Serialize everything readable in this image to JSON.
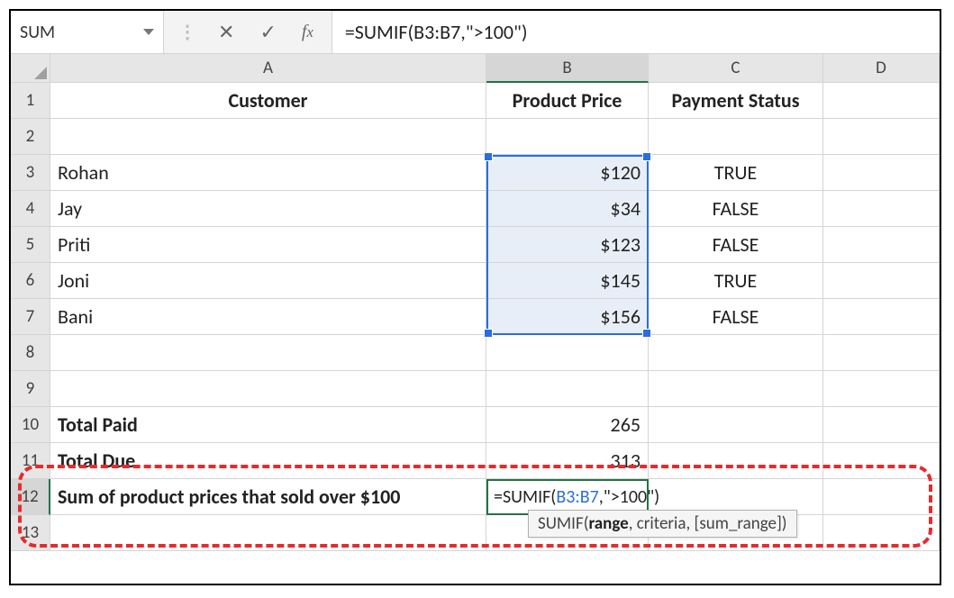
{
  "nameBox": "SUM",
  "formulaBar": "=SUMIF(B3:B7,\">100\")",
  "columns": [
    "A",
    "B",
    "C",
    "D"
  ],
  "headers": {
    "A": "Customer",
    "B": "Product Price",
    "C": "Payment Status"
  },
  "rows": [
    {
      "n": 3,
      "customer": "Rohan",
      "price": "$120",
      "status": "TRUE"
    },
    {
      "n": 4,
      "customer": "Jay",
      "price": "$34",
      "status": "FALSE"
    },
    {
      "n": 5,
      "customer": "Priti",
      "price": "$123",
      "status": "FALSE"
    },
    {
      "n": 6,
      "customer": "Joni",
      "price": "$145",
      "status": "TRUE"
    },
    {
      "n": 7,
      "customer": "Bani",
      "price": "$156",
      "status": "FALSE"
    }
  ],
  "totals": {
    "paidLabel": "Total Paid",
    "paidValue": "265",
    "dueLabel": "Total Due",
    "dueValue": "313"
  },
  "editRow": {
    "label": "Sum of product prices that sold over $100",
    "formulaPrefix": "=SUMIF(",
    "formulaRef": "B3:B7",
    "formulaSuffix": ",\">100\")"
  },
  "tooltip": {
    "fn": "SUMIF",
    "arg1": "range",
    "rest": ", criteria, [sum_range])"
  },
  "rowNums": [
    "1",
    "2",
    "3",
    "4",
    "5",
    "6",
    "7",
    "8",
    "9",
    "10",
    "11",
    "12",
    "13"
  ]
}
